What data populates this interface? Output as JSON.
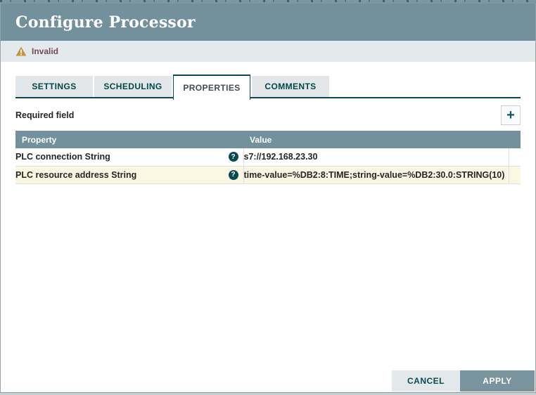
{
  "dialog": {
    "title": "Configure Processor",
    "status_bar": {
      "label": "Invalid"
    },
    "tabs": [
      {
        "label": "SETTINGS",
        "active": false
      },
      {
        "label": "SCHEDULING",
        "active": false
      },
      {
        "label": "PROPERTIES",
        "active": true
      },
      {
        "label": "COMMENTS",
        "active": false
      }
    ],
    "properties": {
      "required_label": "Required field",
      "add_button_glyph": "+",
      "help_icon_glyph": "?",
      "table": {
        "headers": {
          "property": "Property",
          "value": "Value"
        },
        "rows": [
          {
            "property": "PLC connection String",
            "value": "s7://192.168.23.30",
            "highlighted": false
          },
          {
            "property": "PLC resource address String",
            "value": "time-value=%DB2:8:TIME;string-value=%DB2:30.0:STRING(10)",
            "highlighted": true
          }
        ]
      }
    },
    "footer": {
      "cancel_label": "CANCEL",
      "apply_label": "APPLY"
    },
    "colors": {
      "header_bg": "#72919c",
      "status_bar_bg": "#e4e9ec",
      "invalid_text": "#714c52",
      "warning_amber": "#c69244",
      "brand_teal": "#0b4a52",
      "row_highlight_bg": "#fcf7e3",
      "apply_button_bg": "#7a949e"
    }
  }
}
